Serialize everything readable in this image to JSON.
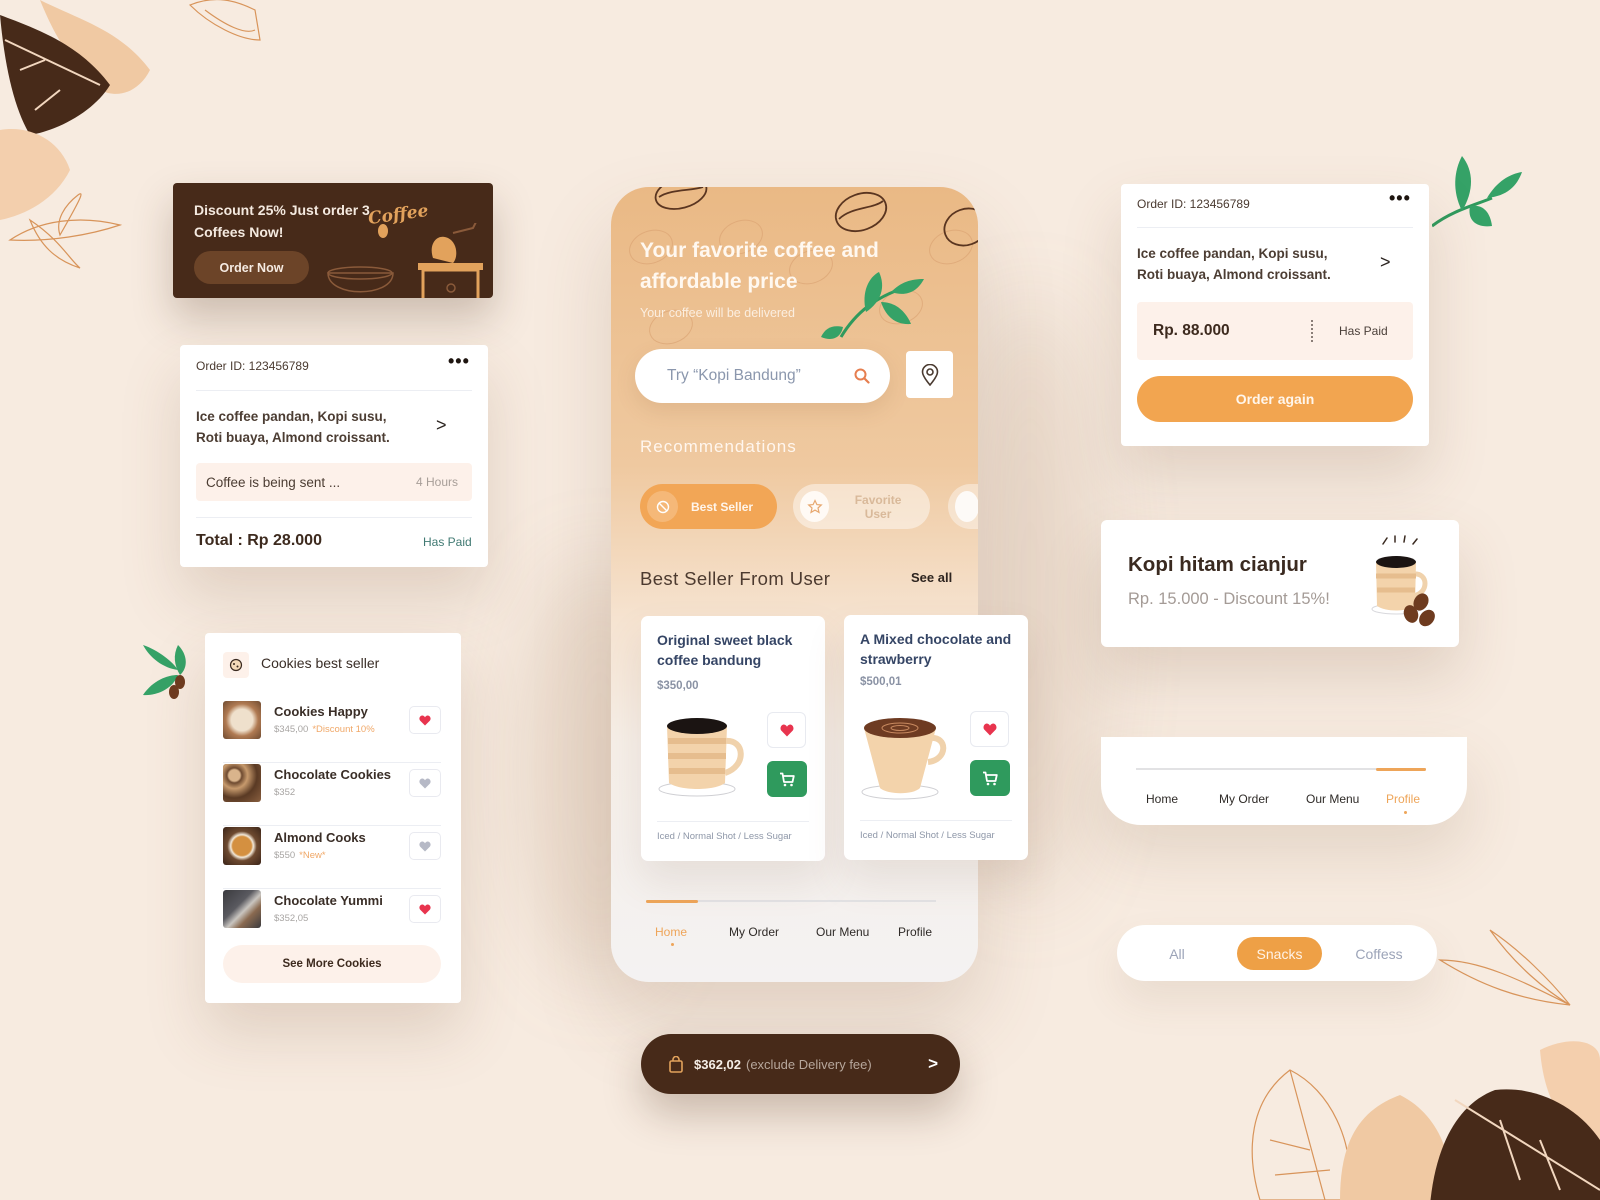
{
  "colors": {
    "background": "#f7ebe0",
    "brown_dark": "#472a19",
    "orange_accent": "#f2a656",
    "green_cart": "#2f9a5d",
    "heart_active": "#e8344e",
    "heart_inactive": "#b6b9c6"
  },
  "promo_banner": {
    "title": "Discount 25% Just order 3 Coffees Now!",
    "button_label": "Order Now",
    "decor_text": "Coffee"
  },
  "order_card_left": {
    "order_id": "Order ID: 123456789",
    "menu_icon": "more-dots-icon",
    "items": "Ice coffee pandan, Kopi susu, Roti buaya, Almond croissant.",
    "status": "Coffee is being sent ...",
    "status_time": "4 Hours",
    "total": "Total : Rp 28.000",
    "payment_status": "Has Paid"
  },
  "cookies_card": {
    "title": "Cookies best seller",
    "items": [
      {
        "name": "Cookies Happy",
        "price": "$345,00",
        "note": "*Discount 10%",
        "favorited": true
      },
      {
        "name": "Chocolate Cookies",
        "price": "$352",
        "note": "",
        "favorited": false
      },
      {
        "name": "Almond Cooks",
        "price": "$550",
        "note": "*New*",
        "favorited": false
      },
      {
        "name": "Chocolate Yummi",
        "price": "$352,05",
        "note": "",
        "favorited": true
      }
    ],
    "see_more_label": "See More Cookies"
  },
  "phone": {
    "hero_title": "Your favorite coffee and affordable price",
    "hero_subtitle": "Your coffee will be delivered",
    "search_placeholder": "Try “Kopi Bandung”",
    "recommendations_title": "Recommendations",
    "chips": [
      {
        "label": "Best Seller",
        "icon": "coffee-bean-icon",
        "active": true
      },
      {
        "label": "Favorite User",
        "icon": "star-icon",
        "active": false
      }
    ],
    "best_seller_title": "Best Seller From User",
    "see_all_label": "See all",
    "products": [
      {
        "name": "Original sweet black coffee bandung",
        "price": "$350,00",
        "options": "Iced / Normal Shot / Less Sugar",
        "favorited": true
      },
      {
        "name": "A Mixed chocolate and strawberry",
        "price": "$500,01",
        "options": "Iced / Normal Shot / Less Sugar",
        "favorited": true
      }
    ],
    "nav": {
      "items": [
        "Home",
        "My Order",
        "Our Menu",
        "Profile"
      ],
      "active": "Home"
    }
  },
  "checkout_bar": {
    "amount": "$362,02",
    "note": "(exclude Delivery fee)"
  },
  "order_card_right": {
    "order_id": "Order ID: 123456789",
    "items": "Ice coffee pandan, Kopi susu, Roti buaya, Almond croissant.",
    "amount": "Rp. 88.000",
    "payment_status": "Has Paid",
    "button_label": "Order again"
  },
  "kopi_card": {
    "title": "Kopi hitam cianjur",
    "subtitle": "Rp. 15.000 - Discount 15%!"
  },
  "nav_card": {
    "items": [
      "Home",
      "My Order",
      "Our Menu",
      "Profile"
    ],
    "active": "Profile"
  },
  "segment_control": {
    "options": [
      "All",
      "Snacks",
      "Coffess"
    ],
    "active": "Snacks"
  }
}
